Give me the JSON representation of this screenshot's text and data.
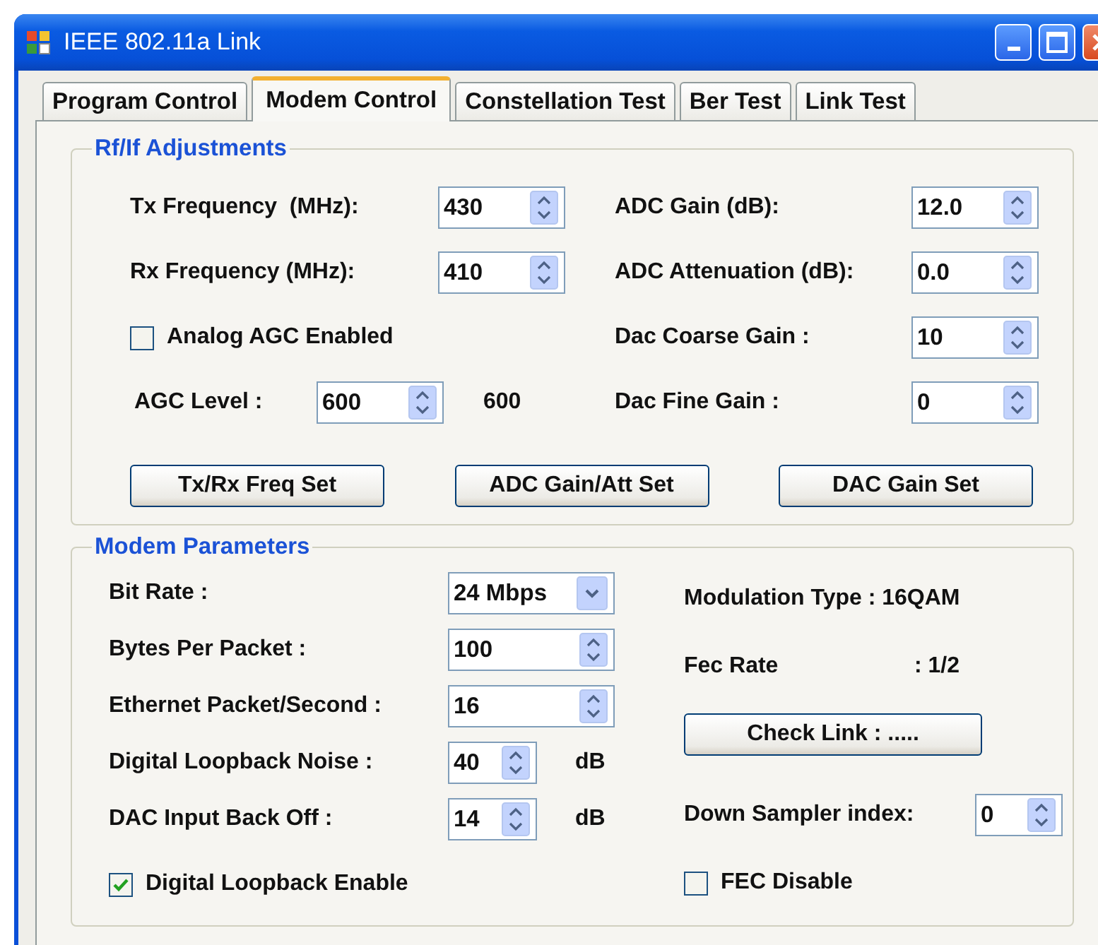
{
  "window": {
    "title": "IEEE 802.11a Link"
  },
  "tabs": [
    {
      "label": "Program Control",
      "selected": false
    },
    {
      "label": "Modem Control",
      "selected": true
    },
    {
      "label": "Constellation Test",
      "selected": false
    },
    {
      "label": "Ber Test",
      "selected": false
    },
    {
      "label": "Link Test",
      "selected": false
    }
  ],
  "rf_if_adjustments": {
    "title": "Rf/If Adjustments",
    "left": [
      {
        "kind": "spin",
        "label": "Tx Frequency  (MHz):",
        "value": "430"
      },
      {
        "kind": "spin",
        "label": "Rx Frequency (MHz):",
        "value": "410"
      },
      {
        "kind": "checkbox",
        "label": "Analog AGC Enabled",
        "checked": false
      },
      {
        "kind": "spin_reading",
        "label": "AGC Level :",
        "value": "600",
        "reading": "600"
      }
    ],
    "right": [
      {
        "kind": "spin",
        "label": "ADC Gain (dB):",
        "value": "12.0"
      },
      {
        "kind": "spin",
        "label": "ADC Attenuation (dB):",
        "value": "0.0"
      },
      {
        "kind": "spin",
        "label": "Dac Coarse Gain :",
        "value": "10"
      },
      {
        "kind": "spin",
        "label": "Dac Fine Gain :",
        "value": "0"
      }
    ],
    "buttons": [
      "Tx/Rx Freq Set",
      "ADC Gain/Att Set",
      "DAC Gain Set"
    ]
  },
  "modem_parameters": {
    "title": "Modem Parameters",
    "left": [
      {
        "kind": "dropdown",
        "label": "Bit Rate :",
        "value": "24 Mbps"
      },
      {
        "kind": "spin",
        "label": "Bytes Per Packet :",
        "value": "100"
      },
      {
        "kind": "spin",
        "label": "Ethernet Packet/Second :",
        "value": "16"
      },
      {
        "kind": "spin_unit",
        "label": "Digital Loopback Noise :",
        "value": "40",
        "unit": "dB"
      },
      {
        "kind": "spin_unit",
        "label": "DAC Input Back Off :",
        "value": "14",
        "unit": "dB"
      },
      {
        "kind": "checkbox",
        "label": "Digital Loopback Enable",
        "checked": true
      }
    ],
    "right": [
      {
        "kind": "text",
        "label": "Modulation Type : 16QAM"
      },
      {
        "kind": "pair",
        "label": "Fec Rate",
        "value": ": 1/2"
      },
      {
        "kind": "button",
        "label": "Check Link : ....."
      },
      {
        "kind": "spin_small",
        "label": "Down Sampler index:",
        "value": "0"
      },
      {
        "kind": "checkbox",
        "label": "FEC Disable",
        "checked": false
      }
    ]
  }
}
